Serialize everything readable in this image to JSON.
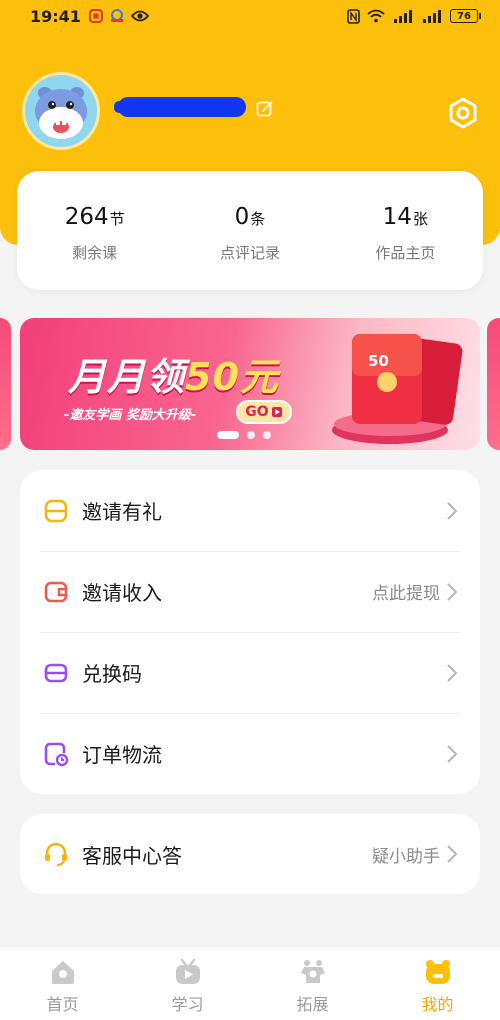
{
  "status_bar": {
    "time": "19:41",
    "battery": "76"
  },
  "profile": {
    "stats": [
      {
        "value": "264",
        "unit": "节",
        "label": "剩余课"
      },
      {
        "value": "0",
        "unit": "条",
        "label": "点评记录"
      },
      {
        "value": "14",
        "unit": "张",
        "label": "作品主页"
      }
    ]
  },
  "banner": {
    "title_prefix": "月月领",
    "title_amount": "50元",
    "subtitle": "-邀友学画 奖励大升级-",
    "cta": "GO",
    "packet_text": "50"
  },
  "menu": [
    {
      "label": "邀请有礼",
      "hint": ""
    },
    {
      "label": "邀请收入",
      "hint": "点此提现"
    },
    {
      "label": "兑换码",
      "hint": ""
    },
    {
      "label": "订单物流",
      "hint": ""
    }
  ],
  "service": {
    "label": "客服中心答",
    "hint": "疑小助手"
  },
  "tabs": [
    {
      "label": "首页"
    },
    {
      "label": "学习"
    },
    {
      "label": "拓展"
    },
    {
      "label": "我的"
    }
  ],
  "colors": {
    "brand_yellow": "#fcbf0c",
    "active_tab": "#f3a700",
    "banner_pink": "#f23f7a"
  }
}
